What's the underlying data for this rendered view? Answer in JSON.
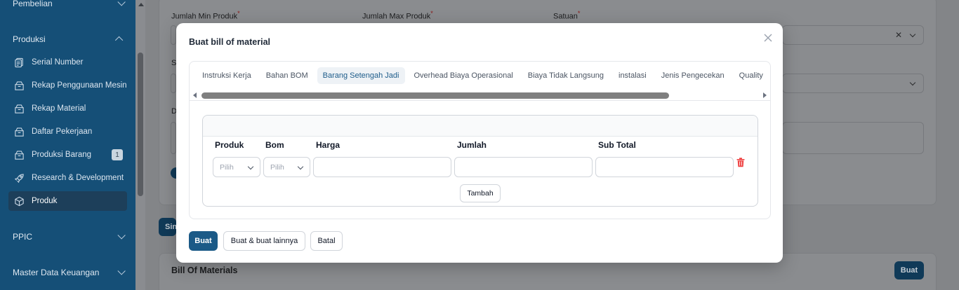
{
  "sidebar": {
    "groups": {
      "pembelian": "Pembelian",
      "produksi": "Produksi",
      "ppic": "PPIC",
      "master_keuangan": "Master Data Keuangan"
    },
    "items": [
      {
        "label": "Serial Number",
        "icon": "document-icon"
      },
      {
        "label": "Rekap Penggunaan Mesin",
        "icon": "box-icon"
      },
      {
        "label": "Rekap Material",
        "icon": "box-icon"
      },
      {
        "label": "Daftar Pekerjaan",
        "icon": "box-icon"
      },
      {
        "label": "Produksi Barang",
        "icon": "box-icon",
        "badge": "1"
      },
      {
        "label": "Research & Development",
        "icon": "rocket-icon"
      },
      {
        "label": "Produk",
        "icon": "cube-icon",
        "active": true
      }
    ]
  },
  "background_form": {
    "min_label": "Jumlah Min Produk",
    "max_label": "Jumlah Max Produk",
    "unit_label": "Satuan",
    "required_mark": "*",
    "s_label": "S",
    "d_label": "D",
    "save_partial": "Sin",
    "bom_title": "Bill Of Materials",
    "bom_create": "Buat"
  },
  "modal": {
    "title": "Buat bill of material",
    "tabs": [
      "Instruksi Kerja",
      "Bahan BOM",
      "Barang Setengah Jadi",
      "Overhead Biaya Operasional",
      "Biaya Tidak Langsung",
      "instalasi",
      "Jenis Pengecekan",
      "Quality"
    ],
    "active_tab": "Barang Setengah Jadi",
    "columns": {
      "produk": "Produk",
      "bom": "Bom",
      "harga": "Harga",
      "jumlah": "Jumlah",
      "subtotal": "Sub Total"
    },
    "row": {
      "produk_placeholder": "Pilih",
      "bom_placeholder": "Pilih",
      "harga": "",
      "jumlah": "",
      "subtotal": ""
    },
    "add_label": "Tambah",
    "buttons": {
      "create": "Buat",
      "create_another": "Buat & buat lainnya",
      "cancel": "Batal"
    }
  },
  "colors": {
    "sidebar_bg": "#154f77",
    "primary": "#1b5a87",
    "danger": "#ef4444",
    "active_tab_text": "#1d5c8a"
  }
}
